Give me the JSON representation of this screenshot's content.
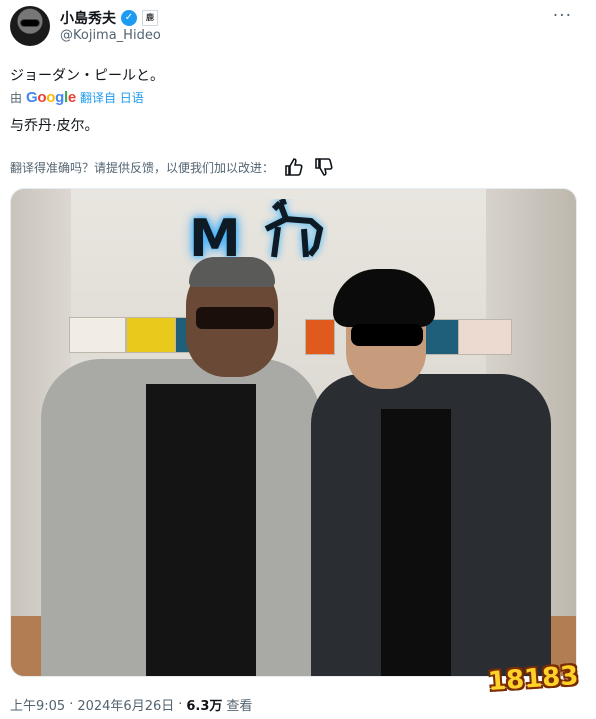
{
  "author": {
    "name": "小島秀夫",
    "handle": "@Kojima_Hideo",
    "affiliation_badge": "鹿",
    "verified_icon": "verified-check-icon",
    "more_label": "···"
  },
  "tweet": {
    "text": "ジョーダン・ピールと。",
    "translated_by_prefix": "由",
    "translated_by_brand": [
      "G",
      "o",
      "o",
      "g",
      "l",
      "e"
    ],
    "translate_link": "翻译自 日语",
    "translated_text": "与乔丹·皮尔。"
  },
  "feedback": {
    "question": "翻译得准确吗？请提供反馈，以便我们加以改进：",
    "up_icon": "thumbs-up-icon",
    "down_icon": "thumbs-down-icon"
  },
  "photo": {
    "sign_text": "M",
    "watermark": "18183"
  },
  "meta": {
    "time": "上午9:05",
    "sep1": "·",
    "date": "2024年6月26日",
    "sep2": "·",
    "views": "6.3万",
    "views_label": "查看"
  },
  "colors": {
    "accent": "#1d9bf0",
    "text_secondary": "#536471",
    "text_primary": "#0f1419"
  }
}
